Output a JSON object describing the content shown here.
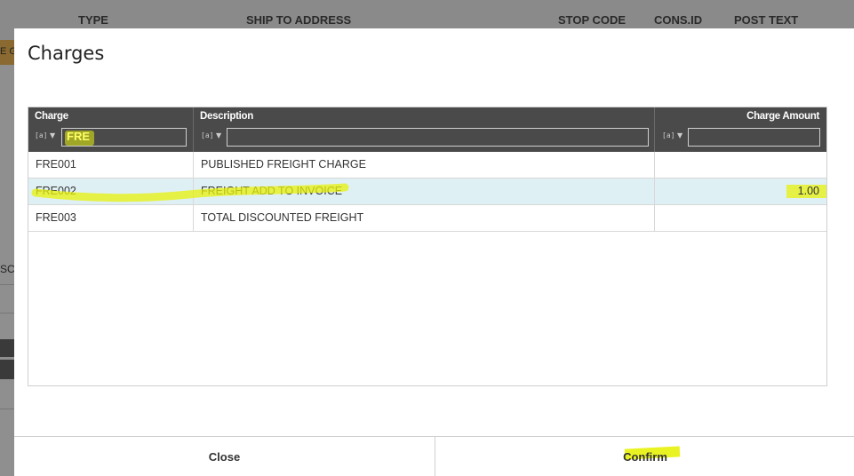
{
  "background": {
    "columns": [
      "TYPE",
      "SHIP TO ADDRESS",
      "STOP CODE",
      "CONS.ID",
      "POST TEXT"
    ],
    "left_tab": "E G",
    "left_label": "SCR"
  },
  "dialog": {
    "title": "Charges",
    "columns": [
      {
        "title": "Charge",
        "filter": "FRE"
      },
      {
        "title": "Description",
        "filter": ""
      },
      {
        "title": "Charge Amount",
        "filter": ""
      }
    ],
    "filter_icon": "[a]",
    "rows": [
      {
        "charge": "FRE001",
        "description": "PUBLISHED FREIGHT CHARGE",
        "amount": ""
      },
      {
        "charge": "FRE002",
        "description": "FREIGHT ADD TO INVOICE",
        "amount": "1.00"
      },
      {
        "charge": "FRE003",
        "description": "TOTAL DISCOUNTED FREIGHT",
        "amount": ""
      }
    ],
    "close_label": "Close",
    "confirm_label": "Confirm"
  },
  "colors": {
    "header_bg": "#4a4a4a",
    "selected_row": "#dff0f5",
    "highlighter": "#e8f20a"
  }
}
